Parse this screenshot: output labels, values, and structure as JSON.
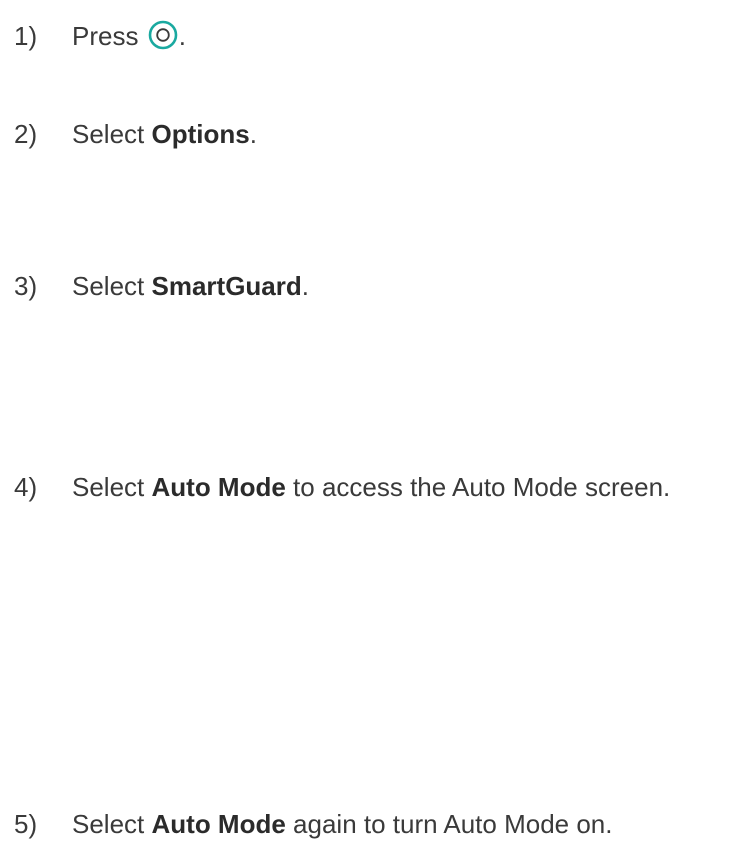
{
  "steps": [
    {
      "number": "1)",
      "text_before": "Press",
      "icon": "home-button-icon",
      "text_after": "."
    },
    {
      "number": "2)",
      "text_before": "Select ",
      "bold": "Options",
      "text_after": "."
    },
    {
      "number": "3)",
      "text_before": "Select ",
      "bold": "SmartGuard",
      "text_after": "."
    },
    {
      "number": "4)",
      "text_before": "Select ",
      "bold": "Auto Mode",
      "text_after": " to access the Auto Mode screen."
    },
    {
      "number": "5)",
      "text_before": "Select ",
      "bold": "Auto Mode",
      "text_after": " again to turn Auto Mode on."
    }
  ],
  "colors": {
    "text": "#3a3a3a",
    "icon_ring": "#1aa9a0"
  }
}
